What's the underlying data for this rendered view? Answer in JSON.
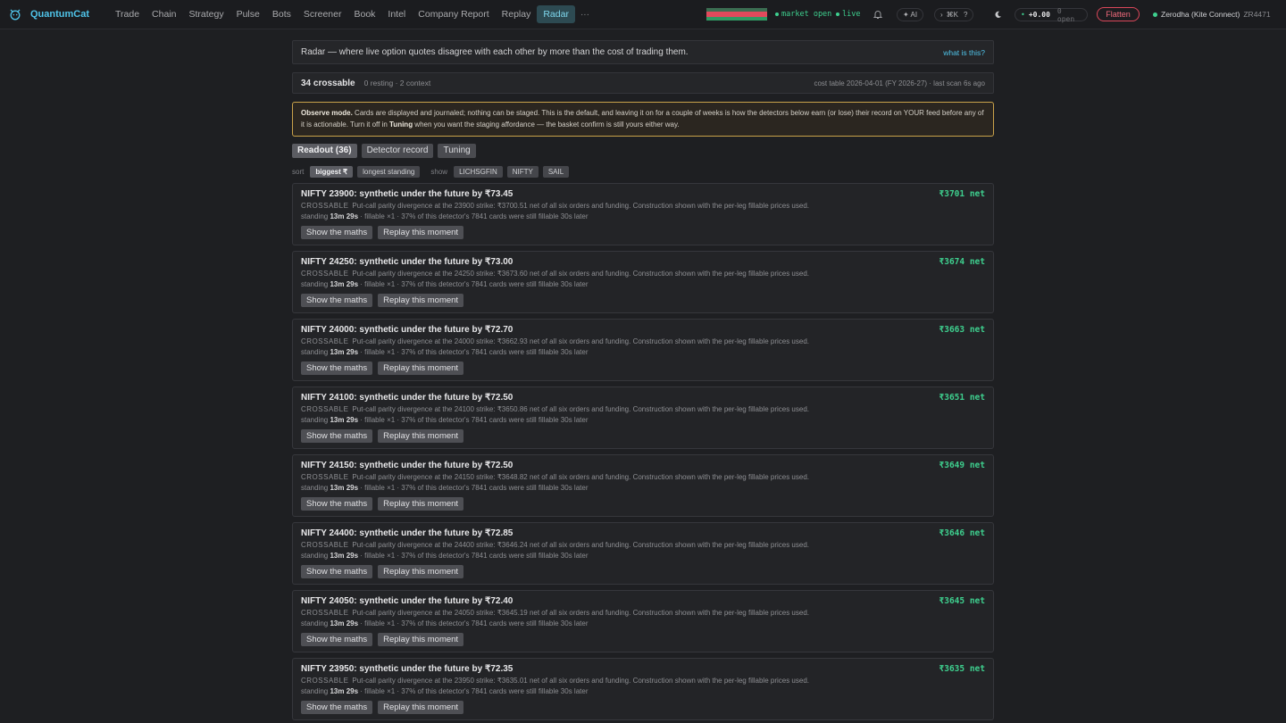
{
  "app": {
    "name": "QuantumCat"
  },
  "nav": [
    "Trade",
    "Chain",
    "Strategy",
    "Pulse",
    "Bots",
    "Screener",
    "Book",
    "Intel",
    "Company Report",
    "Replay",
    "Radar"
  ],
  "nav_active": "Radar",
  "nav_more": "···",
  "status": {
    "market": "market open",
    "live": "live"
  },
  "topbar": {
    "ai": "✦ AI",
    "cmdk": "⌘K",
    "help": "?",
    "pnl": "+0.00",
    "open": "0 open",
    "flatten": "Flatten",
    "broker": "Zerodha (Kite Connect)",
    "user_id": "ZR4471"
  },
  "colors": {
    "accent": "#4fc3e8",
    "positive": "#3ecf8e",
    "negative": "#e04a5c",
    "warning_border": "#c9a24a"
  },
  "intro": {
    "text": "Radar — where live option quotes disagree with each other by more than the cost of trading them.",
    "link": "what is this?"
  },
  "summary": {
    "count": "34 crossable",
    "sub": "0 resting · 2 context",
    "right": "cost table 2026-04-01 (FY 2026-27) · last scan 6s ago"
  },
  "observe": {
    "bold": "Observe mode.",
    "text1": " Cards are displayed and journaled; nothing can be staged. This is the default, and leaving it on for a couple of weeks is how the detectors below earn (or lose) their record on YOUR feed before any of it is actionable. Turn it off in ",
    "bold2": "Tuning",
    "text2": " when you want the staging affordance — the basket confirm is still yours either way."
  },
  "tabs": [
    "Readout (36)",
    "Detector record",
    "Tuning"
  ],
  "filters": {
    "sort_label": "sort",
    "sort": [
      "biggest ₹",
      "longest standing"
    ],
    "show_label": "show",
    "show": [
      "LICHSGFIN",
      "NIFTY",
      "SAIL"
    ]
  },
  "buttons": {
    "maths": "Show the maths",
    "replay": "Replay this moment"
  },
  "cards": [
    {
      "title": "NIFTY 23900: synthetic under the future by ₹73.45",
      "net": "₹3701 net",
      "tag": "CROSSABLE",
      "desc": "Put-call parity divergence at the 23900 strike: ₹3700.51 net of all six orders and funding. Construction shown with the per-leg fillable prices used.",
      "standing_pre": "standing ",
      "standing": "13m 29s",
      "standing_post": " · fillable ×1 · 37% of this detector's 7841 cards were still fillable 30s later"
    },
    {
      "title": "NIFTY 24250: synthetic under the future by ₹73.00",
      "net": "₹3674 net",
      "tag": "CROSSABLE",
      "desc": "Put-call parity divergence at the 24250 strike: ₹3673.60 net of all six orders and funding. Construction shown with the per-leg fillable prices used.",
      "standing_pre": "standing ",
      "standing": "13m 29s",
      "standing_post": " · fillable ×1 · 37% of this detector's 7841 cards were still fillable 30s later"
    },
    {
      "title": "NIFTY 24000: synthetic under the future by ₹72.70",
      "net": "₹3663 net",
      "tag": "CROSSABLE",
      "desc": "Put-call parity divergence at the 24000 strike: ₹3662.93 net of all six orders and funding. Construction shown with the per-leg fillable prices used.",
      "standing_pre": "standing ",
      "standing": "13m 29s",
      "standing_post": " · fillable ×1 · 37% of this detector's 7841 cards were still fillable 30s later"
    },
    {
      "title": "NIFTY 24100: synthetic under the future by ₹72.50",
      "net": "₹3651 net",
      "tag": "CROSSABLE",
      "desc": "Put-call parity divergence at the 24100 strike: ₹3650.86 net of all six orders and funding. Construction shown with the per-leg fillable prices used.",
      "standing_pre": "standing ",
      "standing": "13m 29s",
      "standing_post": " · fillable ×1 · 37% of this detector's 7841 cards were still fillable 30s later"
    },
    {
      "title": "NIFTY 24150: synthetic under the future by ₹72.50",
      "net": "₹3649 net",
      "tag": "CROSSABLE",
      "desc": "Put-call parity divergence at the 24150 strike: ₹3648.82 net of all six orders and funding. Construction shown with the per-leg fillable prices used.",
      "standing_pre": "standing ",
      "standing": "13m 29s",
      "standing_post": " · fillable ×1 · 37% of this detector's 7841 cards were still fillable 30s later"
    },
    {
      "title": "NIFTY 24400: synthetic under the future by ₹72.85",
      "net": "₹3646 net",
      "tag": "CROSSABLE",
      "desc": "Put-call parity divergence at the 24400 strike: ₹3646.24 net of all six orders and funding. Construction shown with the per-leg fillable prices used.",
      "standing_pre": "standing ",
      "standing": "13m 29s",
      "standing_post": " · fillable ×1 · 37% of this detector's 7841 cards were still fillable 30s later"
    },
    {
      "title": "NIFTY 24050: synthetic under the future by ₹72.40",
      "net": "₹3645 net",
      "tag": "CROSSABLE",
      "desc": "Put-call parity divergence at the 24050 strike: ₹3645.19 net of all six orders and funding. Construction shown with the per-leg fillable prices used.",
      "standing_pre": "standing ",
      "standing": "13m 29s",
      "standing_post": " · fillable ×1 · 37% of this detector's 7841 cards were still fillable 30s later"
    },
    {
      "title": "NIFTY 23950: synthetic under the future by ₹72.35",
      "net": "₹3635 net",
      "tag": "CROSSABLE",
      "desc": "Put-call parity divergence at the 23950 strike: ₹3635.01 net of all six orders and funding. Construction shown with the per-leg fillable prices used.",
      "standing_pre": "standing ",
      "standing": "13m 29s",
      "standing_post": " · fillable ×1 · 37% of this detector's 7841 cards were still fillable 30s later"
    }
  ]
}
